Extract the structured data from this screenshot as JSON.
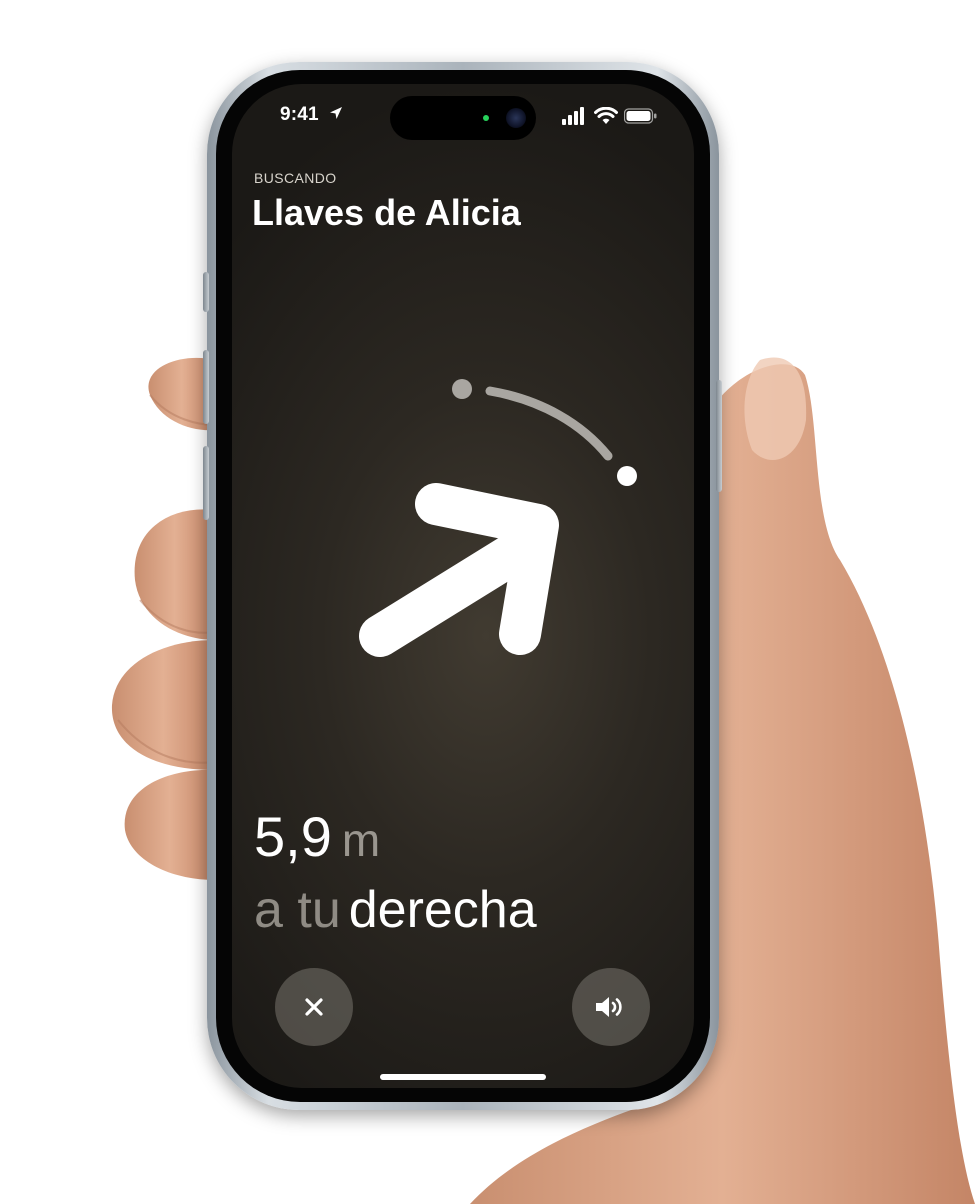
{
  "status_bar": {
    "time": "9:41",
    "location_icon": "location-arrow-icon",
    "signal_icon": "cellular-signal-icon",
    "wifi_icon": "wifi-icon",
    "battery_icon": "battery-icon"
  },
  "header": {
    "status_label": "BUSCANDO",
    "item_name": "Llaves de Alicia"
  },
  "direction_indicator": {
    "arrow_icon": "direction-arrow-icon"
  },
  "distance": {
    "value": "5,9",
    "unit": "m"
  },
  "direction": {
    "prefix": "a tu",
    "word": "derecha"
  },
  "controls": {
    "cancel_icon": "close-icon",
    "sound_icon": "speaker-icon"
  },
  "colors": {
    "screen_background": "#2c2822",
    "text_primary": "#ffffff",
    "text_secondary": "#8f8b84",
    "island_indicator": "#27d15b"
  }
}
